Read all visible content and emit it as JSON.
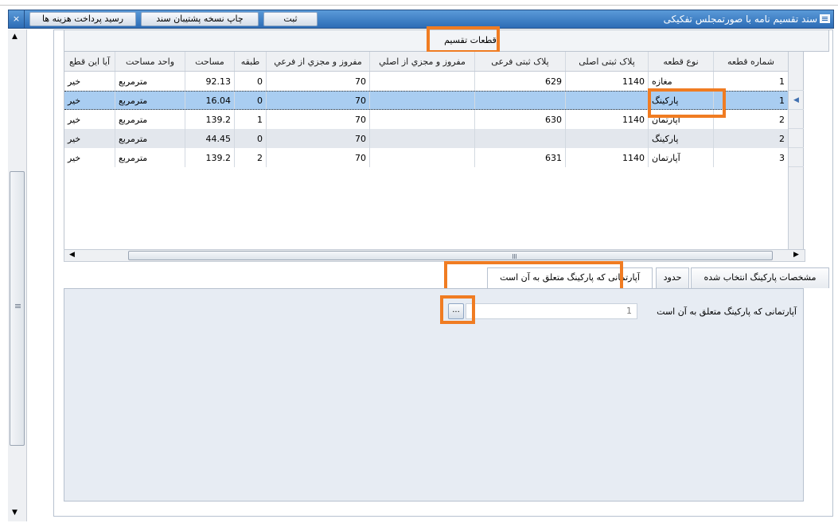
{
  "window": {
    "title": "سند تقسیم نامه با صورتمجلس تفکیکی",
    "close_symbol": "×",
    "buttons": {
      "submit": "ثبت",
      "print_backup": "چاپ نسخه پشتیبان سند",
      "cost_receipt": "رسید پرداخت هزینه ها"
    }
  },
  "group": {
    "caption": "قطعات تقسیم"
  },
  "grid": {
    "columns": {
      "piece_no": "شماره قطعه",
      "piece_type": "نوع قطعه",
      "main_plate": "پلاک ثبتی اصلی",
      "sub_plate": "پلاک ثبتی فرعی",
      "separated_from_main": "مفروز و مجزي از اصلي",
      "separated_from_sub": "مفروز و مجزي از فرعي",
      "floor": "طبقه",
      "area": "مساحت",
      "area_unit": "واحد مساحت",
      "is_piece": "آیا این قطع"
    },
    "rows": [
      {
        "piece_no": "1",
        "piece_type": "مغازه",
        "main_plate": "1140",
        "sub_plate": "629",
        "separated_from_main": "",
        "separated_from_sub": "70",
        "floor": "0",
        "area": "92.13",
        "area_unit": "مترمربع",
        "is_piece": "خیر"
      },
      {
        "piece_no": "1",
        "piece_type": "پارکینگ",
        "main_plate": "",
        "sub_plate": "",
        "separated_from_main": "",
        "separated_from_sub": "70",
        "floor": "0",
        "area": "16.04",
        "area_unit": "مترمربع",
        "is_piece": "خیر"
      },
      {
        "piece_no": "2",
        "piece_type": "آپارتمان",
        "main_plate": "1140",
        "sub_plate": "630",
        "separated_from_main": "",
        "separated_from_sub": "70",
        "floor": "1",
        "area": "139.2",
        "area_unit": "مترمربع",
        "is_piece": "خیر"
      },
      {
        "piece_no": "2",
        "piece_type": "پارکینگ",
        "main_plate": "",
        "sub_plate": "",
        "separated_from_main": "",
        "separated_from_sub": "70",
        "floor": "0",
        "area": "44.45",
        "area_unit": "مترمربع",
        "is_piece": "خیر"
      },
      {
        "piece_no": "3",
        "piece_type": "آپارتمان",
        "main_plate": "1140",
        "sub_plate": "631",
        "separated_from_main": "",
        "separated_from_sub": "70",
        "floor": "2",
        "area": "139.2",
        "area_unit": "مترمربع",
        "is_piece": "خیر"
      }
    ],
    "selected_row_index": 1
  },
  "tabs": {
    "parking_spec": "مشخصات پارکینگ انتخاب شده",
    "bounds": "حدود",
    "apartment_of_parking": "آپارتمانی که پارکینگ متعلق به آن است",
    "active": "apartment_of_parking"
  },
  "detail": {
    "field_label": "آپارتمانی که پارکینگ متعلق به آن است",
    "field_value": "1",
    "browse_label": "..."
  },
  "colors": {
    "highlight": "#f07c22",
    "titlebar": "#2d6cb6",
    "selected_row": "#a9cdf1",
    "alt_row": "#e3e7ed"
  }
}
